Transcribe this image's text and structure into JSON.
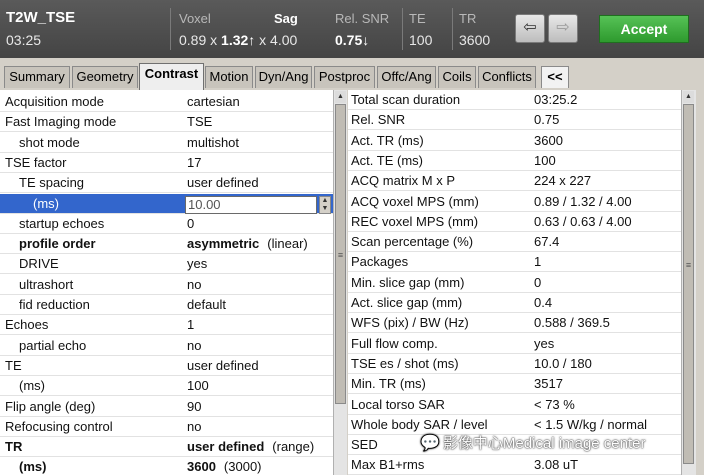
{
  "header": {
    "scan_name": "T2W_TSE",
    "scan_time": "03:25",
    "voxel_label": "Voxel",
    "voxel_values": [
      "0.89 x",
      "1.32",
      "↑",
      "x 4.00"
    ],
    "orientation": "Sag",
    "rel_snr_label": "Rel. SNR",
    "rel_snr_value": "0.75",
    "rel_snr_arrow": "↓",
    "te_label": "TE",
    "te_value": "100",
    "tr_label": "TR",
    "tr_value": "3600",
    "undo_icon": "undo-arrow-icon",
    "redo_icon": "redo-arrow-icon",
    "accept_label": "Accept",
    "accept_color": "#3fae3f"
  },
  "tabs": [
    {
      "label": "Summary"
    },
    {
      "label": "Geometry"
    },
    {
      "label": "Contrast",
      "active": true
    },
    {
      "label": "Motion"
    },
    {
      "label": "Dyn/Ang"
    },
    {
      "label": "Postproc"
    },
    {
      "label": "Offc/Ang"
    },
    {
      "label": "Coils"
    },
    {
      "label": "Conflicts"
    },
    {
      "label": "<<"
    }
  ],
  "left_params": [
    {
      "label": "Acquisition mode",
      "value": "cartesian",
      "indent": 0
    },
    {
      "label": "Fast Imaging mode",
      "value": "TSE",
      "indent": 0
    },
    {
      "label": "shot mode",
      "value": "multishot",
      "indent": 1
    },
    {
      "label": "TSE factor",
      "value": "17",
      "indent": 0
    },
    {
      "label": "TE spacing",
      "value": "user defined",
      "indent": 1
    },
    {
      "label": "(ms)",
      "value": "10.00",
      "indent": 2,
      "editing": true
    },
    {
      "label": "startup echoes",
      "value": "0",
      "indent": 1
    },
    {
      "label": "profile order",
      "value": "asymmetric",
      "extra": "(linear)",
      "indent": 1,
      "bold": true
    },
    {
      "label": "DRIVE",
      "value": "yes",
      "indent": 1
    },
    {
      "label": "ultrashort",
      "value": "no",
      "indent": 1
    },
    {
      "label": "fid reduction",
      "value": "default",
      "indent": 1
    },
    {
      "label": "Echoes",
      "value": "1",
      "indent": 0
    },
    {
      "label": "partial echo",
      "value": "no",
      "indent": 1
    },
    {
      "label": "TE",
      "value": "user defined",
      "indent": 0
    },
    {
      "label": "(ms)",
      "value": "100",
      "indent": 1
    },
    {
      "label": "Flip angle (deg)",
      "value": "90",
      "indent": 0
    },
    {
      "label": "Refocusing control",
      "value": "no",
      "indent": 0
    },
    {
      "label": "TR",
      "value": "user defined",
      "extra": "(range)",
      "indent": 0,
      "bold": true
    },
    {
      "label": "(ms)",
      "value": "3600",
      "extra": "(3000)",
      "indent": 1,
      "bold": true
    }
  ],
  "right_params": [
    {
      "label": "Total scan duration",
      "value": "03:25.2"
    },
    {
      "label": "Rel. SNR",
      "value": "0.75"
    },
    {
      "label": "Act. TR (ms)",
      "value": "3600"
    },
    {
      "label": "Act. TE (ms)",
      "value": "100"
    },
    {
      "label": "ACQ matrix M x P",
      "value": "224 x 227"
    },
    {
      "label": "ACQ voxel MPS (mm)",
      "value": "0.89 / 1.32 / 4.00"
    },
    {
      "label": "REC voxel MPS (mm)",
      "value": "0.63 / 0.63 / 4.00"
    },
    {
      "label": "Scan percentage (%)",
      "value": "67.4"
    },
    {
      "label": "Packages",
      "value": "1"
    },
    {
      "label": "Min. slice gap (mm)",
      "value": "0"
    },
    {
      "label": "Act. slice gap (mm)",
      "value": "0.4"
    },
    {
      "label": "WFS (pix) / BW (Hz)",
      "value": "0.588 / 369.5"
    },
    {
      "label": "Full flow comp.",
      "value": "yes"
    },
    {
      "label": "TSE es / shot (ms)",
      "value": "10.0 / 180"
    },
    {
      "label": "Min. TR (ms)",
      "value": "3517"
    },
    {
      "label": "Local torso SAR",
      "value": "< 73 %"
    },
    {
      "label": "Whole body SAR / level",
      "value": "< 1.5 W/kg / normal"
    },
    {
      "label": "SED",
      "value": ""
    },
    {
      "label": "Max B1+rms",
      "value": "3.08 uT"
    }
  ],
  "watermark": {
    "icon": "wechat-icon",
    "text": "影像中心Medical image center"
  }
}
